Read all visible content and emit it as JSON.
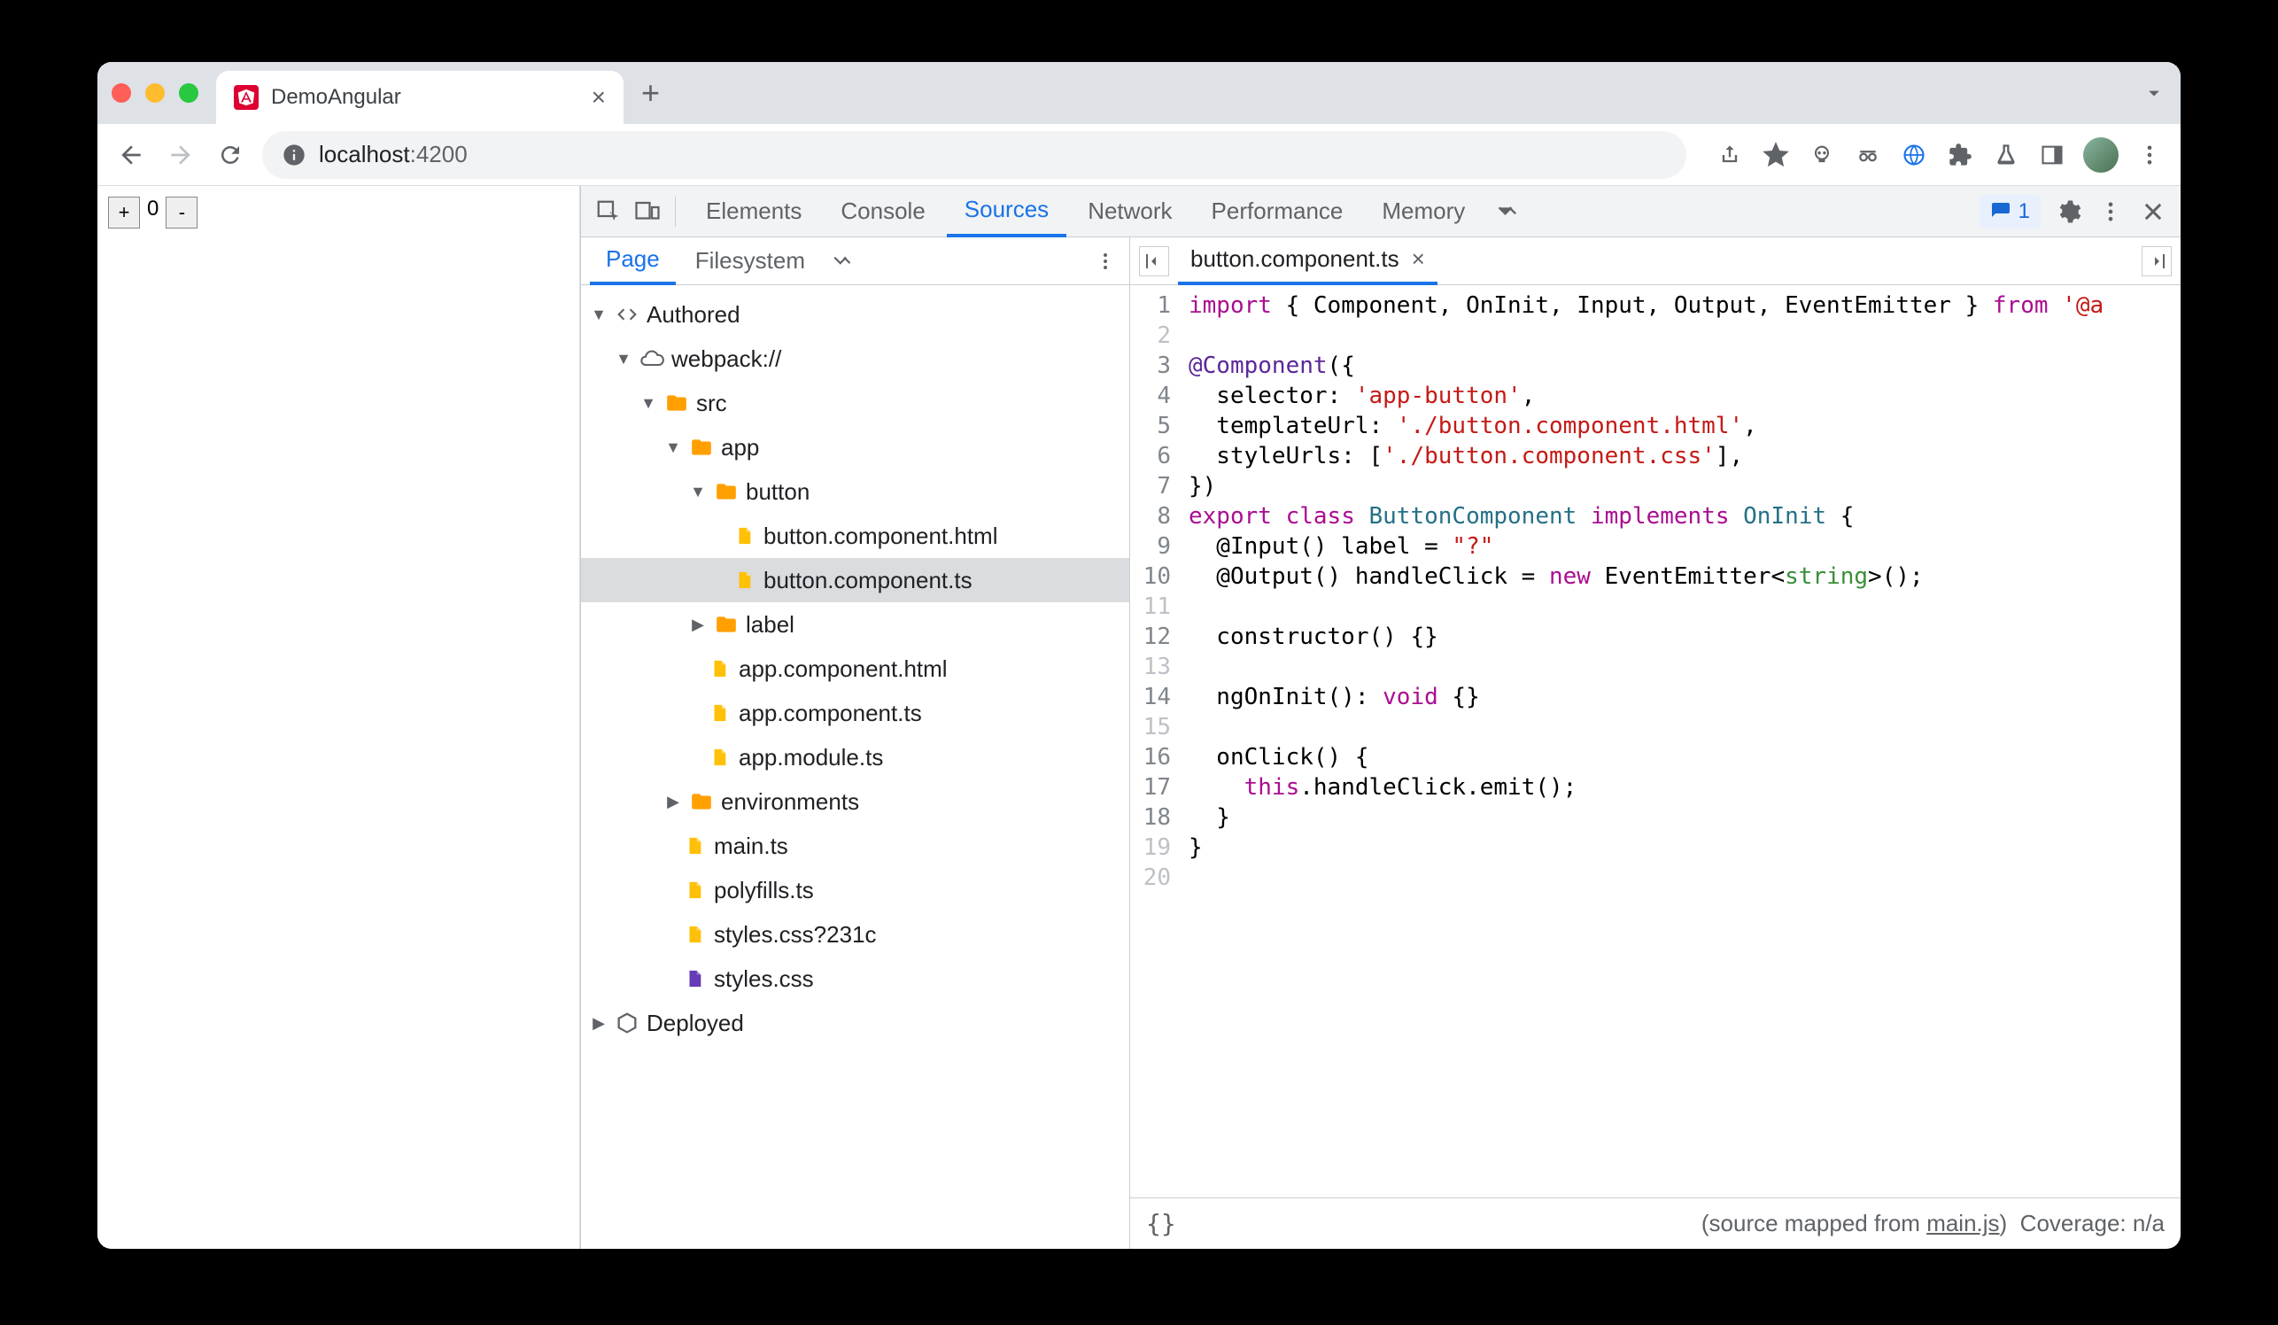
{
  "browser": {
    "tab_title": "DemoAngular",
    "url_host": "localhost",
    "url_port": ":4200"
  },
  "page": {
    "counter_value": "0",
    "plus": "+",
    "minus": "-"
  },
  "devtools": {
    "tabs": [
      "Elements",
      "Console",
      "Sources",
      "Network",
      "Performance",
      "Memory"
    ],
    "active_tab": "Sources",
    "issues_count": "1",
    "nav_tabs": [
      "Page",
      "Filesystem"
    ],
    "active_nav_tab": "Page"
  },
  "tree": {
    "authored": "Authored",
    "webpack": "webpack://",
    "src": "src",
    "app": "app",
    "button": "button",
    "button_html": "button.component.html",
    "button_ts": "button.component.ts",
    "label": "label",
    "app_html": "app.component.html",
    "app_ts": "app.component.ts",
    "app_module": "app.module.ts",
    "environments": "environments",
    "main_ts": "main.ts",
    "polyfills": "polyfills.ts",
    "styles_q": "styles.css?231c",
    "styles": "styles.css",
    "deployed": "Deployed"
  },
  "editor": {
    "filename": "button.component.ts",
    "line_numbers": [
      "1",
      "2",
      "3",
      "4",
      "5",
      "6",
      "7",
      "8",
      "9",
      "10",
      "11",
      "12",
      "13",
      "14",
      "15",
      "16",
      "17",
      "18",
      "19",
      "20"
    ],
    "breakpoint_dim": [
      2,
      11,
      13,
      15,
      19,
      20
    ],
    "footer_left": "{}",
    "footer_source": "(source mapped from ",
    "footer_link": "main.js",
    "footer_close": ")",
    "footer_coverage": "Coverage: n/a",
    "code": {
      "l1a": "import",
      "l1b": " { Component, OnInit, Input, Output, EventEmitter } ",
      "l1c": "from",
      "l1d": " '@a",
      "l3a": "@Component",
      "l3b": "({",
      "l4a": "  selector: ",
      "l4b": "'app-button'",
      "l4c": ",",
      "l5a": "  templateUrl: ",
      "l5b": "'./button.component.html'",
      "l5c": ",",
      "l6a": "  styleUrls: [",
      "l6b": "'./button.component.css'",
      "l6c": "],",
      "l7": "})",
      "l8a": "export",
      "l8b": " class ",
      "l8c": "ButtonComponent",
      "l8d": " implements ",
      "l8e": "OnInit",
      "l8f": " {",
      "l9a": "  @Input() label = ",
      "l9b": "\"?\"",
      "l10a": "  @Output() handleClick = ",
      "l10b": "new",
      "l10c": " EventEmitter<",
      "l10d": "string",
      "l10e": ">();",
      "l12": "  constructor() {}",
      "l14a": "  ngOnInit(): ",
      "l14b": "void",
      "l14c": " {}",
      "l16": "  onClick() {",
      "l17a": "    ",
      "l17b": "this",
      "l17c": ".handleClick.emit();",
      "l18": "  }",
      "l19": "}"
    }
  }
}
